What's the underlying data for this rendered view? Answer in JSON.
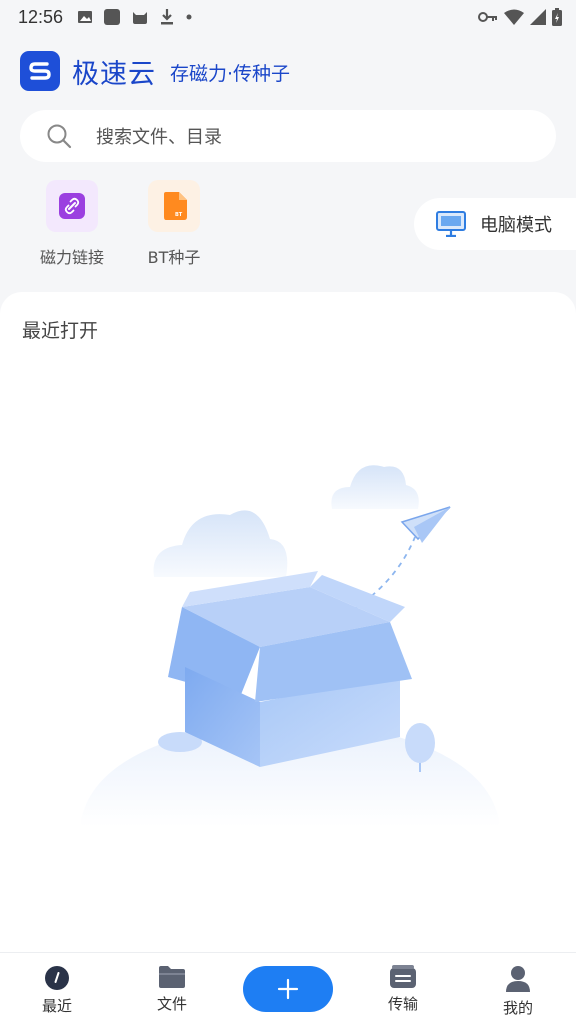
{
  "status_bar": {
    "time": "12:56",
    "icons": [
      "image-icon",
      "square-app-icon",
      "cat-app-icon",
      "download-icon",
      "dot-icon"
    ],
    "right_icons": [
      "key-icon",
      "wifi-icon",
      "signal-icon",
      "battery-icon"
    ]
  },
  "header": {
    "app_name": "极速云",
    "tagline": "存磁力·传种子"
  },
  "search": {
    "placeholder": "搜索文件、目录"
  },
  "tools": [
    {
      "label": "磁力链接",
      "icon": "link-icon",
      "color": "#9b3fe0"
    },
    {
      "label": "BT种子",
      "icon": "bt-file-icon",
      "color": "#ff8a1f"
    }
  ],
  "pc_mode": {
    "label": "电脑模式"
  },
  "recent": {
    "title": "最近打开"
  },
  "bottom_nav": {
    "items": [
      {
        "label": "最近",
        "icon": "clock-icon",
        "active": true
      },
      {
        "label": "文件",
        "icon": "folder-icon",
        "active": false
      },
      {
        "label": "传输",
        "icon": "transfer-icon",
        "active": false
      },
      {
        "label": "我的",
        "icon": "person-icon",
        "active": false
      }
    ],
    "add_icon": "plus-icon"
  },
  "colors": {
    "brand": "#1e4fd8",
    "accent": "#1e7ef3",
    "background": "#f5f6f8"
  }
}
